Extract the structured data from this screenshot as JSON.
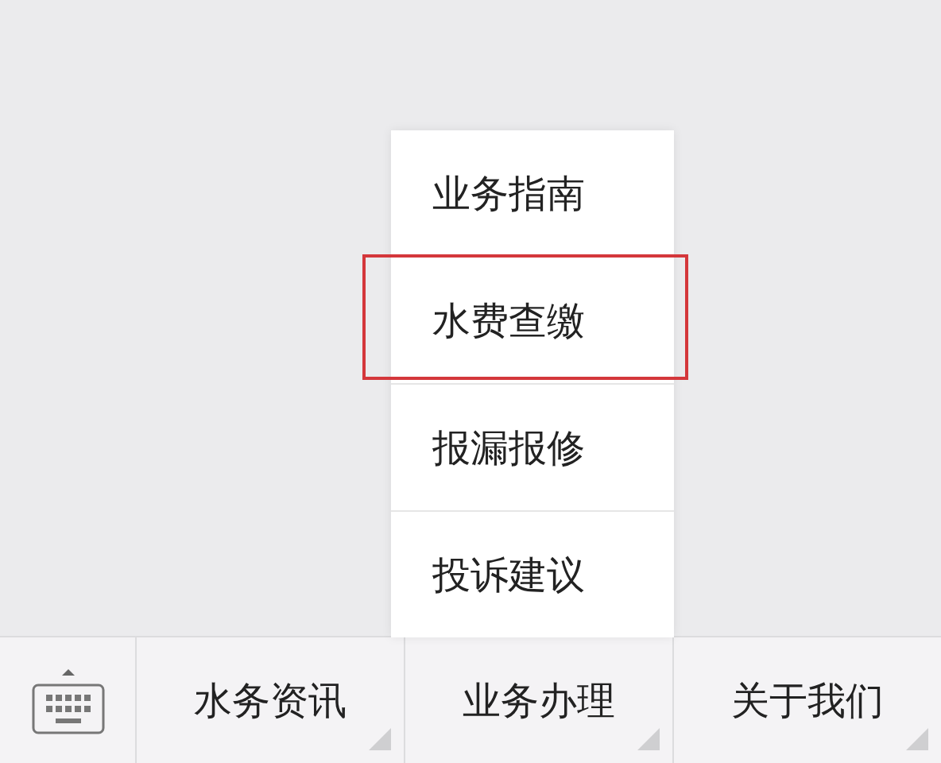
{
  "menu_bar": {
    "items": [
      {
        "label": "水务资讯"
      },
      {
        "label": "业务办理",
        "submenu": [
          {
            "label": "业务指南",
            "highlighted": false
          },
          {
            "label": "水费查缴",
            "highlighted": true
          },
          {
            "label": "报漏报修",
            "highlighted": false
          },
          {
            "label": "投诉建议",
            "highlighted": false
          }
        ]
      },
      {
        "label": "关于我们"
      }
    ]
  }
}
